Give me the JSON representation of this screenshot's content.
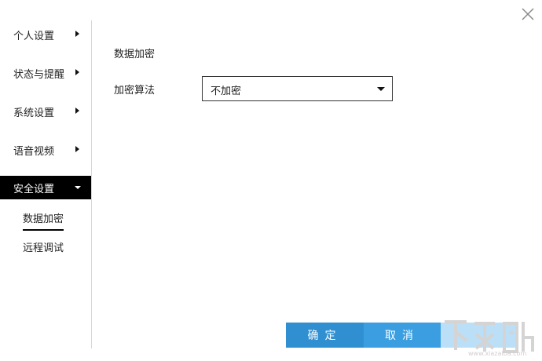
{
  "sidebar": {
    "items": [
      {
        "label": "个人设置"
      },
      {
        "label": "状态与提醒"
      },
      {
        "label": "系统设置"
      },
      {
        "label": "语音视频"
      },
      {
        "label": "安全设置"
      }
    ],
    "sub_items": [
      {
        "label": "数据加密"
      },
      {
        "label": "远程调试"
      }
    ]
  },
  "content": {
    "section_title": "数据加密",
    "algorithm_label": "加密算法",
    "algorithm_value": "不加密"
  },
  "footer": {
    "ok_label": "确定",
    "cancel_label": "取消"
  },
  "watermark": {
    "logo": "下载吧",
    "url": "www.xiazaiba.com"
  },
  "icons": {
    "close": "close-icon",
    "expand": "triangle-right-icon",
    "collapse": "triangle-down-icon",
    "dropdown": "caret-down-icon"
  },
  "colors": {
    "active_bg": "#000000",
    "button_blue": "#2f8fd1"
  }
}
